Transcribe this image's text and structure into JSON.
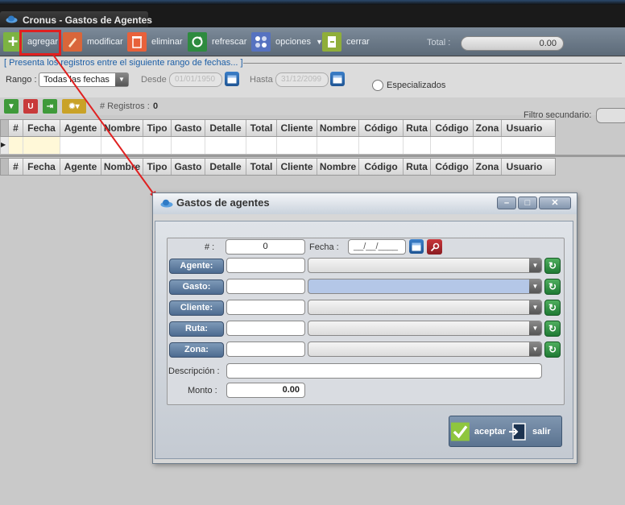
{
  "window": {
    "title": "Cronus - Gastos de Agentes"
  },
  "toolbar": {
    "buttons": [
      {
        "label": "agregar",
        "icon": "plus-icon"
      },
      {
        "label": "modificar",
        "icon": "pencil-icon"
      },
      {
        "label": "eliminar",
        "icon": "trash-icon"
      },
      {
        "label": "refrescar",
        "icon": "refresh-icon"
      },
      {
        "label": "opciones",
        "icon": "options-icon"
      },
      {
        "label": "cerrar",
        "icon": "exit-icon"
      }
    ],
    "total_label": "Total :",
    "total_value": "0.00"
  },
  "filters": {
    "legend": "[ Presenta los registros entre el siguiente rango de fechas... ]",
    "rango_label": "Rango :",
    "rango_value": "Todas las fechas",
    "desde_label": "Desde",
    "desde_value": "01/01/1950",
    "hasta_label": "Hasta",
    "hasta_value": "31/12/2099",
    "especializados_label": "Especializados"
  },
  "list": {
    "registros_label": "# Registros :",
    "registros_count": "0",
    "filtro_label": "Filtro secundario:"
  },
  "grid": {
    "columns": [
      "#",
      "Fecha",
      "Agente",
      "Nombre",
      "Tipo",
      "Gasto",
      "Detalle",
      "Total",
      "Cliente",
      "Nombre",
      "Código",
      "Ruta",
      "Código",
      "Zona",
      "Usuario"
    ]
  },
  "dialog": {
    "title": "Gastos de agentes",
    "num_label": "# :",
    "num_value": "0",
    "fecha_label": "Fecha :",
    "fecha_value": "__/__/____",
    "agente_label": "Agente:",
    "gasto_label": "Gasto:",
    "cliente_label": "Cliente:",
    "ruta_label": "Ruta:",
    "zona_label": "Zona:",
    "descripcion_label": "Descripción :",
    "monto_label": "Monto :",
    "monto_value": "0.00",
    "aceptar_label": "aceptar",
    "salir_label": "salir"
  },
  "colors": {
    "accent": "#1d5fa6",
    "highlight": "#b4c7e7",
    "annotation": "#e02020"
  }
}
